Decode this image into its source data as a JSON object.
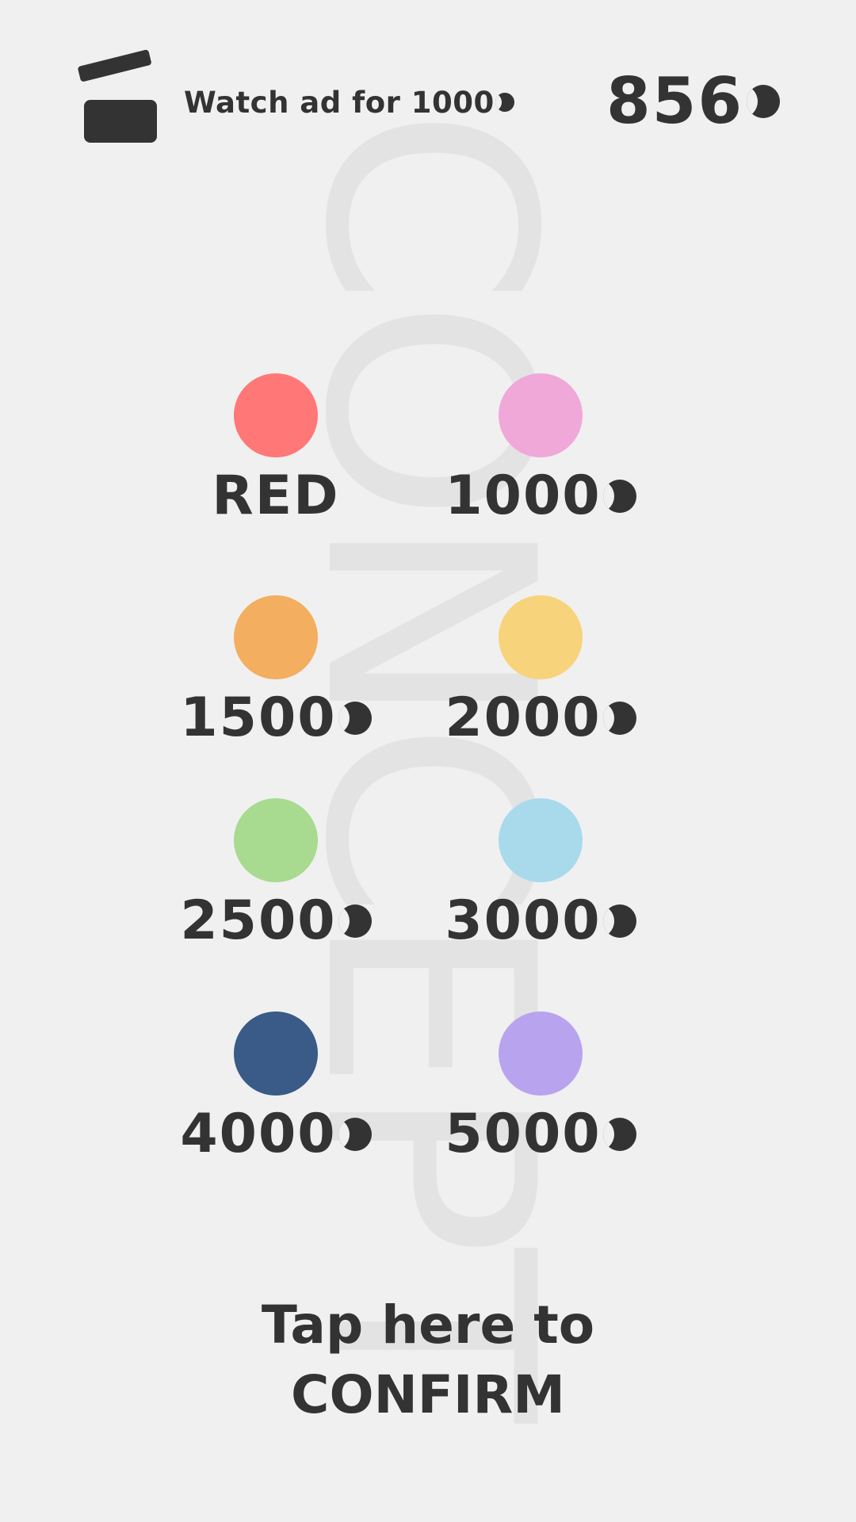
{
  "watermark": "CONCEPT",
  "header": {
    "ad_label": "Watch ad for 1000",
    "balance": "856"
  },
  "colors": {
    "text": "#333333",
    "background": "#f0f0f0"
  },
  "options": [
    {
      "label": "RED",
      "color": "#ff7777",
      "selected": true,
      "shows_coin": false
    },
    {
      "label": "1000",
      "color": "#f0a8d8",
      "selected": false,
      "shows_coin": true
    },
    {
      "label": "1500",
      "color": "#f4ae5f",
      "selected": false,
      "shows_coin": true
    },
    {
      "label": "2000",
      "color": "#f7d37b",
      "selected": false,
      "shows_coin": true
    },
    {
      "label": "2500",
      "color": "#a8da90",
      "selected": false,
      "shows_coin": true
    },
    {
      "label": "3000",
      "color": "#a8daec",
      "selected": false,
      "shows_coin": true
    },
    {
      "label": "4000",
      "color": "#3a5a88",
      "selected": false,
      "shows_coin": true
    },
    {
      "label": "5000",
      "color": "#b8a4ee",
      "selected": false,
      "shows_coin": true
    }
  ],
  "confirm": {
    "line1": "Tap here to",
    "line2": "CONFIRM"
  }
}
